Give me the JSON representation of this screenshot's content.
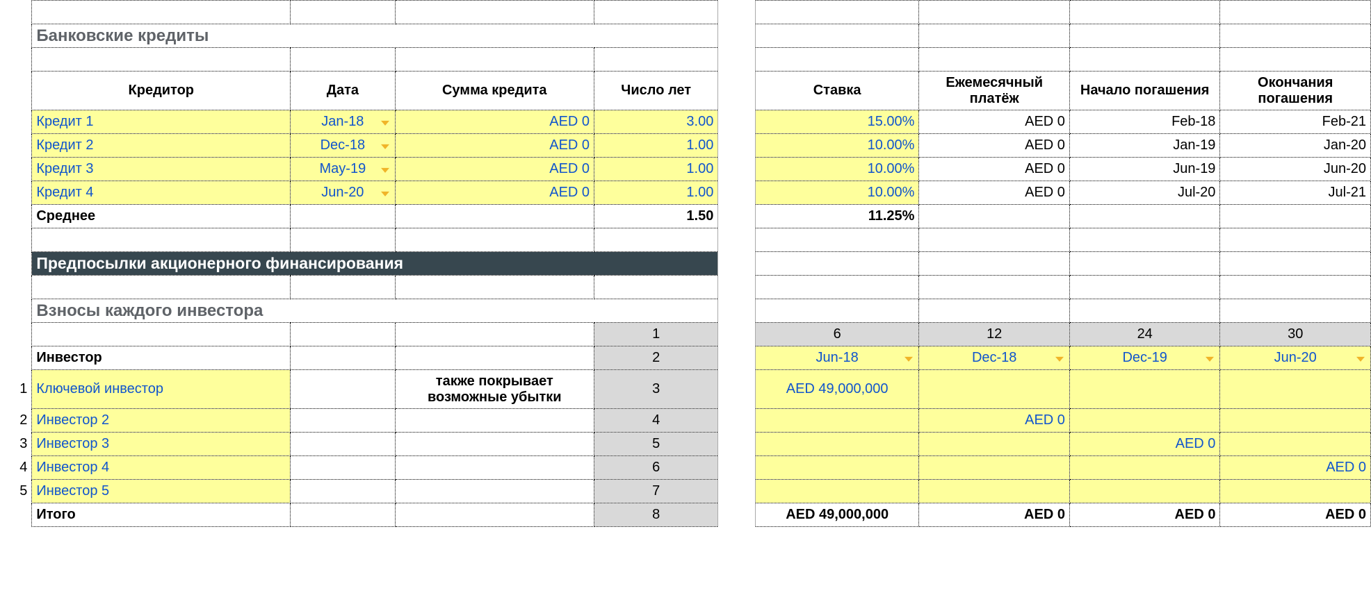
{
  "section_bank": "Банковские кредиты",
  "bank_headers": {
    "creditor": "Кредитор",
    "date": "Дата",
    "loan_amount": "Сумма кредита",
    "years": "Число лет",
    "rate": "Ставка",
    "monthly": "Ежемесячный платёж",
    "start": "Начало погашения",
    "end": "Окончания погашения"
  },
  "loans": [
    {
      "name": "Кредит 1",
      "date": "Jan-18",
      "amount": "AED 0",
      "years": "3.00",
      "rate": "15.00%",
      "monthly": "AED 0",
      "start": "Feb-18",
      "end": "Feb-21"
    },
    {
      "name": "Кредит 2",
      "date": "Dec-18",
      "amount": "AED 0",
      "years": "1.00",
      "rate": "10.00%",
      "monthly": "AED 0",
      "start": "Jan-19",
      "end": "Jan-20"
    },
    {
      "name": "Кредит 3",
      "date": "May-19",
      "amount": "AED 0",
      "years": "1.00",
      "rate": "10.00%",
      "monthly": "AED 0",
      "start": "Jun-19",
      "end": "Jun-20"
    },
    {
      "name": "Кредит 4",
      "date": "Jun-20",
      "amount": "AED 0",
      "years": "1.00",
      "rate": "10.00%",
      "monthly": "AED 0",
      "start": "Jul-20",
      "end": "Jul-21"
    }
  ],
  "avg_label": "Среднее",
  "avg_years": "1.50",
  "avg_rate": "11.25%",
  "section_equity": "Предпосылки акционерного финансирования",
  "section_contrib": "Взносы каждого инвестора",
  "month_idx": [
    "1",
    "6",
    "12",
    "24",
    "30"
  ],
  "investor_header": "Инвестор",
  "schedule_dates": [
    "Jun-18",
    "Dec-18",
    "Dec-19",
    "Jun-20"
  ],
  "investor_note": "также покрывает возможные убытки",
  "row_idx2": "2",
  "investor_rows": [
    {
      "num": "1",
      "name": "Ключевой инвестор",
      "idx": "3",
      "v": [
        "AED 49,000,000",
        "",
        "",
        ""
      ]
    },
    {
      "num": "2",
      "name": "Инвестор 2",
      "idx": "4",
      "v": [
        "",
        "AED 0",
        "",
        ""
      ]
    },
    {
      "num": "3",
      "name": "Инвестор 3",
      "idx": "5",
      "v": [
        "",
        "",
        "AED 0",
        ""
      ]
    },
    {
      "num": "4",
      "name": "Инвестор 4",
      "idx": "6",
      "v": [
        "",
        "",
        "",
        "AED 0"
      ]
    },
    {
      "num": "5",
      "name": "Инвестор 5",
      "idx": "7",
      "v": [
        "",
        "",
        "",
        ""
      ]
    }
  ],
  "total_label": "Итого",
  "total_idx": "8",
  "totals": [
    "AED 49,000,000",
    "AED 0",
    "AED 0",
    "AED 0"
  ],
  "chart_data": {
    "type": "table",
    "tables": [
      {
        "name": "Банковские кредиты",
        "columns": [
          "Кредитор",
          "Дата",
          "Сумма кредита",
          "Число лет",
          "Ставка",
          "Ежемесячный платёж",
          "Начало погашения",
          "Окончания погашения"
        ],
        "rows": [
          [
            "Кредит 1",
            "Jan-18",
            "AED 0",
            3.0,
            "15.00%",
            "AED 0",
            "Feb-18",
            "Feb-21"
          ],
          [
            "Кредит 2",
            "Dec-18",
            "AED 0",
            1.0,
            "10.00%",
            "AED 0",
            "Jan-19",
            "Jan-20"
          ],
          [
            "Кредит 3",
            "May-19",
            "AED 0",
            1.0,
            "10.00%",
            "AED 0",
            "Jun-19",
            "Jun-20"
          ],
          [
            "Кредит 4",
            "Jun-20",
            "AED 0",
            1.0,
            "10.00%",
            "AED 0",
            "Jul-20",
            "Jul-21"
          ]
        ],
        "summary": {
          "Среднее": {
            "Число лет": 1.5,
            "Ставка": "11.25%"
          }
        }
      },
      {
        "name": "Взносы каждого инвестора",
        "columns": [
          "Инвестор",
          "Jun-18",
          "Dec-18",
          "Dec-19",
          "Jun-20"
        ],
        "column_months": [
          6,
          12,
          24,
          30
        ],
        "rows": [
          [
            "Ключевой инвестор",
            "AED 49,000,000",
            "",
            "",
            ""
          ],
          [
            "Инвестор 2",
            "",
            "AED 0",
            "",
            ""
          ],
          [
            "Инвестор 3",
            "",
            "",
            "AED 0",
            ""
          ],
          [
            "Инвестор 4",
            "",
            "",
            "",
            "AED 0"
          ],
          [
            "Инвестор 5",
            "",
            "",
            "",
            ""
          ]
        ],
        "totals": [
          "AED 49,000,000",
          "AED 0",
          "AED 0",
          "AED 0"
        ]
      }
    ]
  }
}
